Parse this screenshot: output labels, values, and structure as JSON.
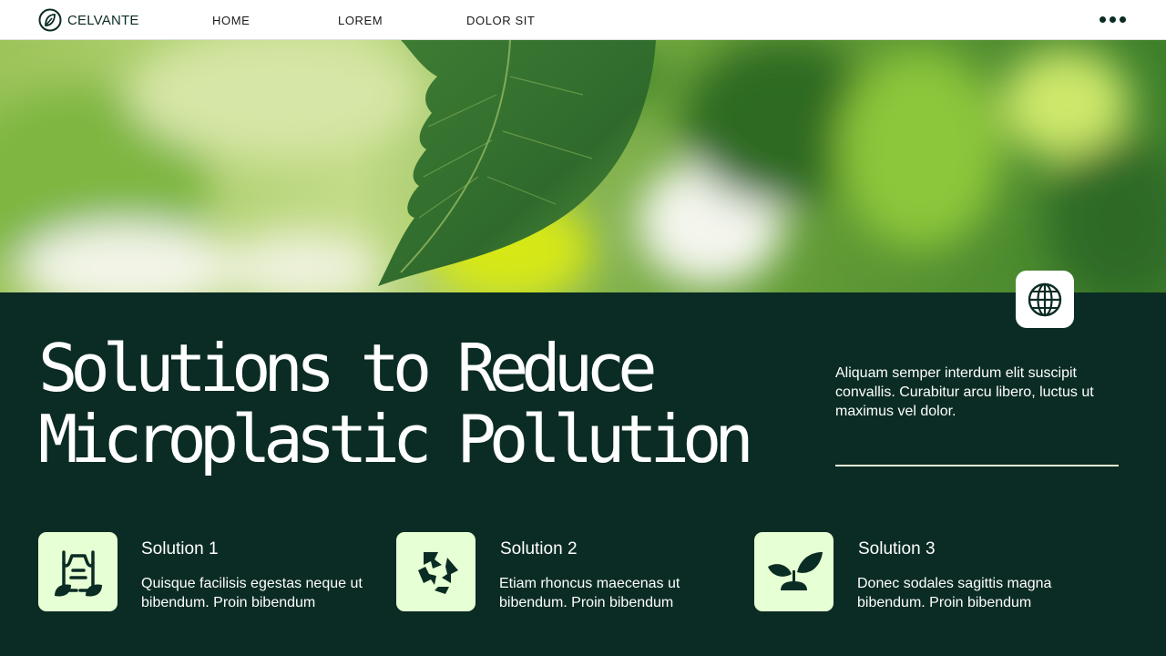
{
  "brand": {
    "name": "CELVANTE",
    "icon": "leaf-logo-icon"
  },
  "nav": {
    "links": [
      "HOME",
      "LOREM",
      "DOLOR SIT"
    ],
    "more_icon": "more-dots-icon"
  },
  "hero": {
    "image": "green-leaf-photo",
    "badge_icon": "globe-icon"
  },
  "heading": {
    "line1": "Solutions to Reduce",
    "line2": "Microplastic Pollution"
  },
  "intro": "Aliquam semper interdum elit suscipit convallis. Curabitur arcu libero, luctus ut maximus vel dolor.",
  "solutions": [
    {
      "title": "Solution 1",
      "text": "Quisque facilisis egestas neque ut bibendum. Proin bibendum",
      "icon": "plastic-bag-icon"
    },
    {
      "title": "Solution 2",
      "text": "Etiam rhoncus maecenas ut bibendum. Proin bibendum",
      "icon": "recycle-icon"
    },
    {
      "title": "Solution 3",
      "text": "Donec sodales sagittis magna bibendum. Proin bibendum",
      "icon": "sprout-icon"
    }
  ],
  "colors": {
    "dark_green": "#0b2c24",
    "mint": "#e6ffd4",
    "white": "#ffffff"
  }
}
